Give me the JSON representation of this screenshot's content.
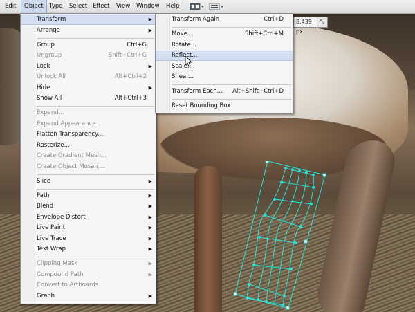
{
  "menubar": {
    "items": [
      "Edit",
      "Object",
      "Type",
      "Select",
      "Effect",
      "View",
      "Window",
      "Help"
    ],
    "active": "Object"
  },
  "controls": {
    "width_value": "8,439 px"
  },
  "object_menu": {
    "items": [
      {
        "label": "Transform",
        "shortcut": "",
        "submenu": true,
        "disabled": false,
        "highlighted": true
      },
      {
        "label": "Arrange",
        "shortcut": "",
        "submenu": true,
        "disabled": false
      },
      {
        "label": "Group",
        "shortcut": "Ctrl+G",
        "submenu": false,
        "disabled": false
      },
      {
        "label": "Ungroup",
        "shortcut": "Shift+Ctrl+G",
        "submenu": false,
        "disabled": true
      },
      {
        "label": "Lock",
        "shortcut": "",
        "submenu": true,
        "disabled": false
      },
      {
        "label": "Unlock All",
        "shortcut": "Alt+Ctrl+2",
        "submenu": false,
        "disabled": true
      },
      {
        "label": "Hide",
        "shortcut": "",
        "submenu": true,
        "disabled": false
      },
      {
        "label": "Show All",
        "shortcut": "Alt+Ctrl+3",
        "submenu": false,
        "disabled": false
      },
      {
        "label": "Expand...",
        "shortcut": "",
        "submenu": false,
        "disabled": true
      },
      {
        "label": "Expand Appearance",
        "shortcut": "",
        "submenu": false,
        "disabled": true
      },
      {
        "label": "Flatten Transparency...",
        "shortcut": "",
        "submenu": false,
        "disabled": false
      },
      {
        "label": "Rasterize...",
        "shortcut": "",
        "submenu": false,
        "disabled": false
      },
      {
        "label": "Create Gradient Mesh...",
        "shortcut": "",
        "submenu": false,
        "disabled": true
      },
      {
        "label": "Create Object Mosaic...",
        "shortcut": "",
        "submenu": false,
        "disabled": true
      },
      {
        "label": "Slice",
        "shortcut": "",
        "submenu": true,
        "disabled": false
      },
      {
        "label": "Path",
        "shortcut": "",
        "submenu": true,
        "disabled": false
      },
      {
        "label": "Blend",
        "shortcut": "",
        "submenu": true,
        "disabled": false
      },
      {
        "label": "Envelope Distort",
        "shortcut": "",
        "submenu": true,
        "disabled": false
      },
      {
        "label": "Live Paint",
        "shortcut": "",
        "submenu": true,
        "disabled": false
      },
      {
        "label": "Live Trace",
        "shortcut": "",
        "submenu": true,
        "disabled": false
      },
      {
        "label": "Text Wrap",
        "shortcut": "",
        "submenu": true,
        "disabled": false
      },
      {
        "label": "Clipping Mask",
        "shortcut": "",
        "submenu": true,
        "disabled": true
      },
      {
        "label": "Compound Path",
        "shortcut": "",
        "submenu": true,
        "disabled": true
      },
      {
        "label": "Convert to Artboards",
        "shortcut": "",
        "submenu": false,
        "disabled": true
      },
      {
        "label": "Graph",
        "shortcut": "",
        "submenu": true,
        "disabled": false
      }
    ]
  },
  "transform_menu": {
    "items": [
      {
        "label": "Transform Again",
        "shortcut": "Ctrl+D"
      },
      {
        "label": "Move...",
        "shortcut": "Shift+Ctrl+M"
      },
      {
        "label": "Rotate...",
        "shortcut": ""
      },
      {
        "label": "Reflect...",
        "shortcut": "",
        "highlighted": true
      },
      {
        "label": "Scale...",
        "shortcut": ""
      },
      {
        "label": "Shear...",
        "shortcut": ""
      },
      {
        "label": "Transform Each...",
        "shortcut": "Alt+Shift+Ctrl+D"
      },
      {
        "label": "Reset Bounding Box",
        "shortcut": ""
      }
    ]
  },
  "colors": {
    "highlight": "#d4e0f2",
    "mesh": "#22e6dc",
    "disabled_text": "#8f8f8f"
  }
}
